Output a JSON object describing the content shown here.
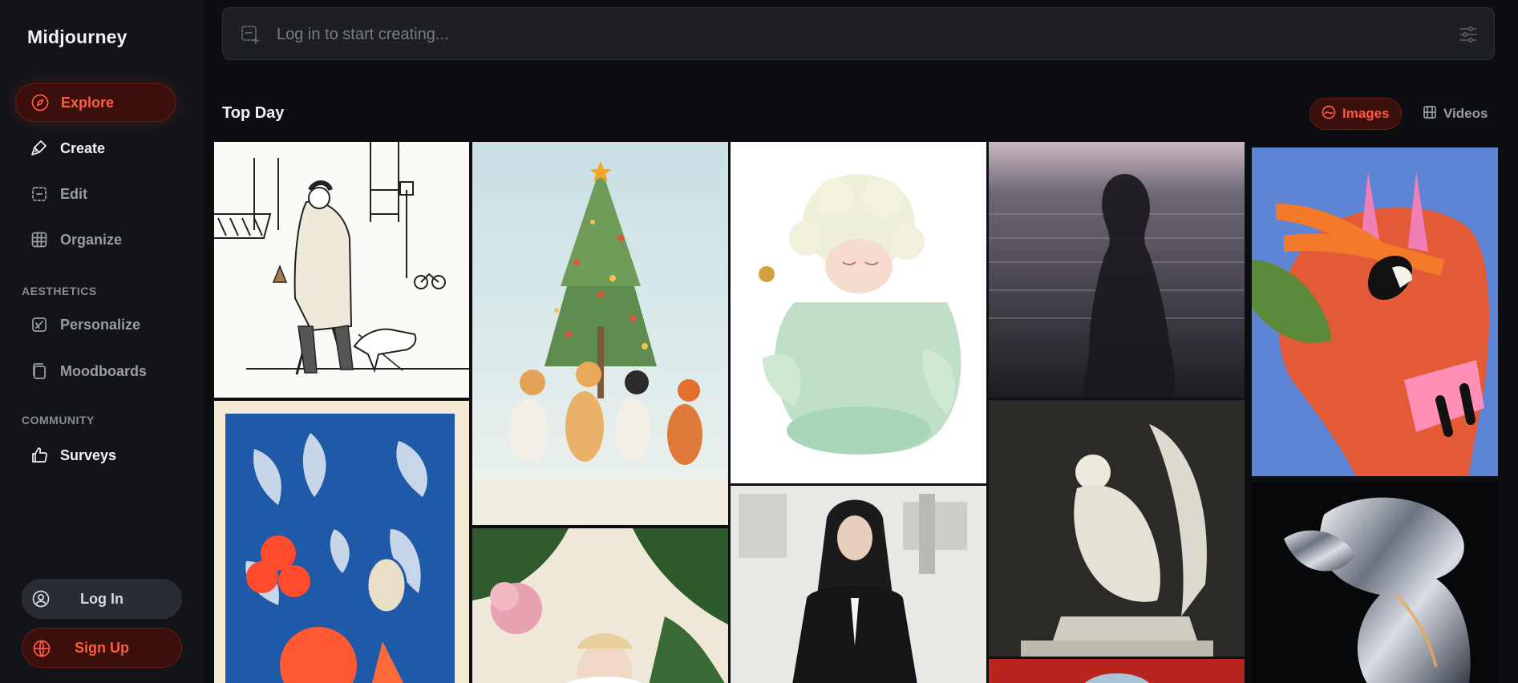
{
  "app": {
    "brand": "Midjourney"
  },
  "sidebar": {
    "nav": [
      {
        "label": "Explore",
        "icon": "compass-icon",
        "active": true
      },
      {
        "label": "Create",
        "icon": "brush-icon"
      },
      {
        "label": "Edit",
        "icon": "edit-icon"
      },
      {
        "label": "Organize",
        "icon": "grid-icon"
      }
    ],
    "aesthetics_label": "AESTHETICS",
    "aesthetics": [
      {
        "label": "Personalize",
        "icon": "palette-icon"
      },
      {
        "label": "Moodboards",
        "icon": "moodboard-icon"
      }
    ],
    "community_label": "COMMUNITY",
    "community": [
      {
        "label": "Surveys",
        "icon": "thumbs-up-icon"
      }
    ],
    "login_label": "Log In",
    "signup_label": "Sign Up"
  },
  "prompt": {
    "placeholder": "Log in to start creating..."
  },
  "gallery": {
    "title": "Top Day",
    "toggle_images": "Images",
    "toggle_videos": "Videos"
  },
  "colors": {
    "accent": "#ff5b3e",
    "accent_bg": "#3a0f0c",
    "sidebar_bg": "#131419",
    "page_bg": "#0d0e12"
  }
}
